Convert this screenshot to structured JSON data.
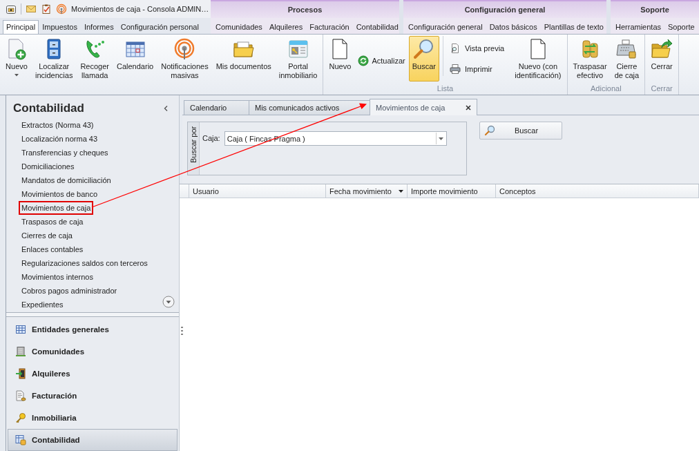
{
  "window": {
    "title": "Movimientos de caja - Consola ADMIN…"
  },
  "ribbon_tabs": [
    {
      "label": "Principal",
      "selected": true
    },
    {
      "label": "Impuestos",
      "selected": false
    },
    {
      "label": "Informes",
      "selected": false
    },
    {
      "label": "Configuración personal",
      "selected": false
    }
  ],
  "context_groups": [
    {
      "title": "Procesos",
      "tabs": [
        {
          "label": "Comunidades",
          "selected": false
        },
        {
          "label": "Alquileres",
          "selected": false
        },
        {
          "label": "Facturación",
          "selected": false
        },
        {
          "label": "Contabilidad",
          "selected": false
        }
      ]
    },
    {
      "title": "Configuración general",
      "tabs": [
        {
          "label": "Configuración general",
          "selected": false
        },
        {
          "label": "Datos básicos",
          "selected": false
        },
        {
          "label": "Plantillas de texto",
          "selected": false
        }
      ]
    },
    {
      "title": "Soporte",
      "tabs": [
        {
          "label": "Herramientas",
          "selected": false
        },
        {
          "label": "Soporte",
          "selected": false
        }
      ]
    }
  ],
  "ribbon": {
    "groups": [
      {
        "buttons": [
          {
            "kind": "large",
            "label": "Nuevo",
            "dropdown": true,
            "pressed": false
          },
          {
            "kind": "large",
            "label": "Localizar\nincidencias",
            "dropdown": false,
            "pressed": false
          },
          {
            "kind": "large",
            "label": "Recoger\nllamada",
            "dropdown": false,
            "pressed": false
          },
          {
            "kind": "large",
            "label": "Calendario",
            "dropdown": false,
            "pressed": false
          },
          {
            "kind": "large",
            "label": "Notificaciones\nmasivas",
            "dropdown": false,
            "pressed": false
          },
          {
            "kind": "large",
            "label": "Mis documentos",
            "dropdown": false,
            "pressed": false
          },
          {
            "kind": "large",
            "label": "Portal\ninmobiliario",
            "dropdown": false,
            "pressed": false
          }
        ]
      },
      {
        "label": "Lista",
        "buttons": [
          {
            "kind": "large",
            "label": "Nuevo",
            "dropdown": false,
            "pressed": false
          },
          {
            "kind": "inline",
            "label": "Actualizar",
            "pressed": false
          },
          {
            "kind": "large",
            "label": "Buscar",
            "dropdown": false,
            "pressed": true
          },
          {
            "kind": "stack",
            "items": [
              {
                "label": "Vista previa",
                "pressed": false
              },
              {
                "label": "Imprimir",
                "pressed": false
              }
            ]
          },
          {
            "kind": "large",
            "label": "Nuevo (con\nidentificación)",
            "dropdown": false,
            "pressed": false
          }
        ]
      },
      {
        "label": "Adicional",
        "buttons": [
          {
            "kind": "large",
            "label": "Traspasar\nefectivo",
            "dropdown": false,
            "pressed": false
          },
          {
            "kind": "large",
            "label": "Cierre\nde caja",
            "dropdown": false,
            "pressed": false
          }
        ]
      },
      {
        "label": "Cerrar",
        "buttons": [
          {
            "kind": "large",
            "label": "Cerrar",
            "dropdown": false,
            "pressed": false
          }
        ]
      }
    ]
  },
  "sidebar": {
    "title": "Contabilidad",
    "items": [
      {
        "label": "Extractos (Norma 43)",
        "highlighted": false
      },
      {
        "label": "Localización norma 43",
        "highlighted": false
      },
      {
        "label": "Transferencias y cheques",
        "highlighted": false
      },
      {
        "label": "Domiciliaciones",
        "highlighted": false
      },
      {
        "label": "Mandatos de domiciliación",
        "highlighted": false
      },
      {
        "label": "Movimientos de banco",
        "highlighted": false
      },
      {
        "label": "Movimientos de caja",
        "highlighted": true
      },
      {
        "label": "Traspasos de caja",
        "highlighted": false
      },
      {
        "label": "Cierres de caja",
        "highlighted": false
      },
      {
        "label": "Enlaces contables",
        "highlighted": false
      },
      {
        "label": "Regularizaciones saldos con terceros",
        "highlighted": false
      },
      {
        "label": "Movimientos internos",
        "highlighted": false
      },
      {
        "label": "Cobros pagos administrador",
        "highlighted": false
      },
      {
        "label": "Expedientes",
        "highlighted": false
      }
    ],
    "sections": [
      {
        "label": "Entidades generales",
        "selected": false
      },
      {
        "label": "Comunidades",
        "selected": false
      },
      {
        "label": "Alquileres",
        "selected": false
      },
      {
        "label": "Facturación",
        "selected": false
      },
      {
        "label": "Inmobiliaria",
        "selected": false
      },
      {
        "label": "Contabilidad",
        "selected": true
      }
    ]
  },
  "document_tabs": [
    {
      "label": "Calendario",
      "selected": false
    },
    {
      "label": "Mis comunicados activos",
      "selected": false
    },
    {
      "label": "Movimientos de caja",
      "selected": true
    }
  ],
  "search_panel": {
    "legend": "Buscar por",
    "field_label": "Caja:",
    "field_value": "Caja ( Fincas Pragma )",
    "button": "Buscar"
  },
  "grid": {
    "columns": [
      {
        "label": "Usuario",
        "sorted": false
      },
      {
        "label": "Fecha movimiento",
        "sorted": true
      },
      {
        "label": "Importe movimiento",
        "sorted": false
      },
      {
        "label": "Conceptos",
        "sorted": false
      }
    ]
  }
}
